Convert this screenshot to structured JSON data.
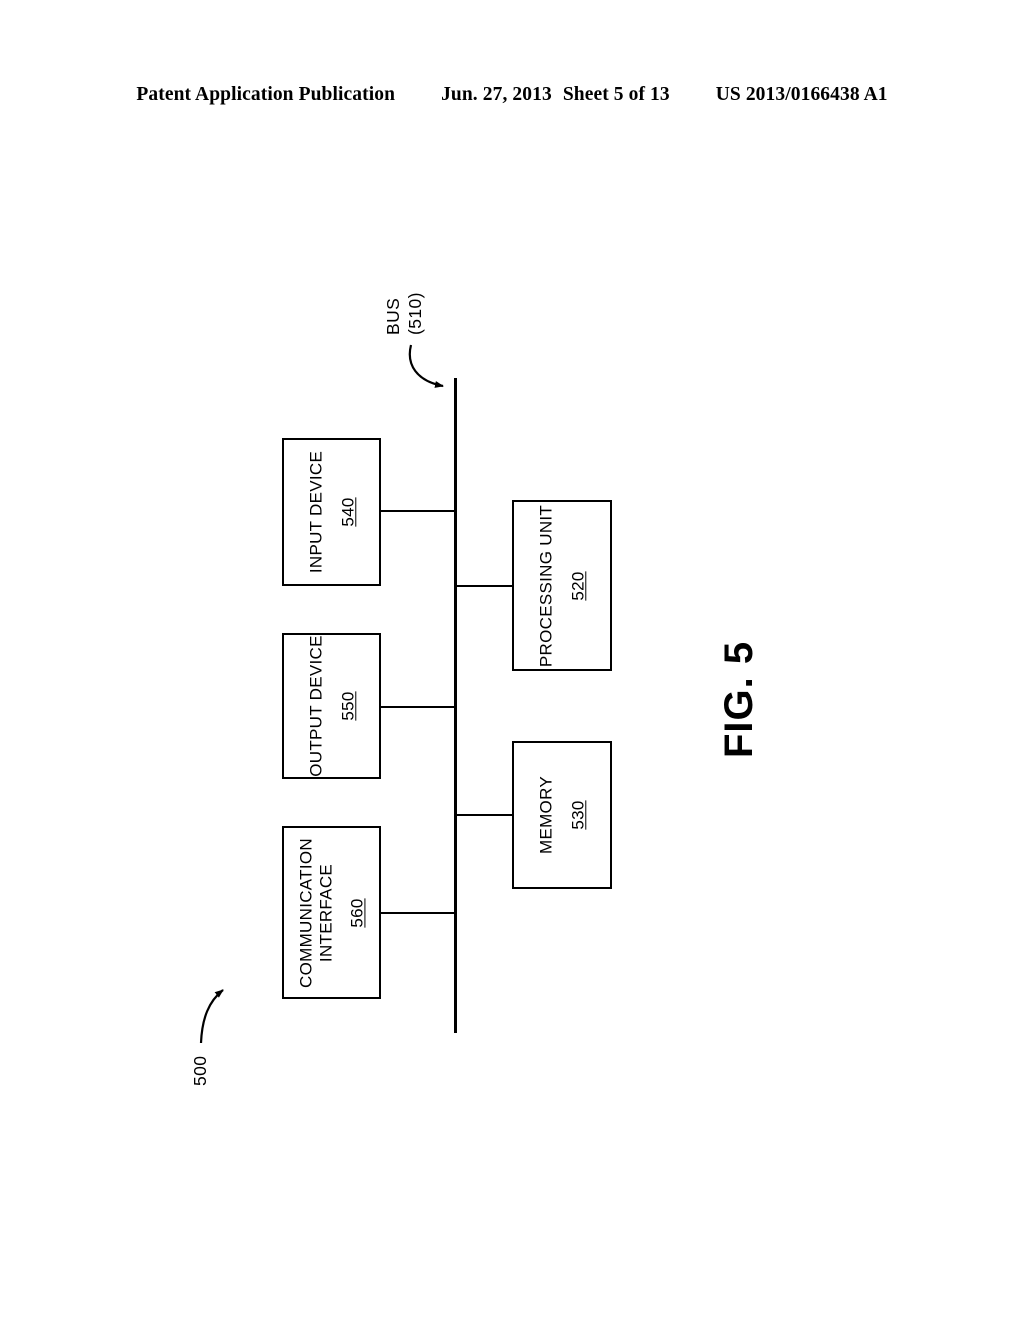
{
  "header": {
    "publication": "Patent Application Publication",
    "date": "Jun. 27, 2013",
    "sheet": "Sheet 5 of 13",
    "document_number": "US 2013/0166438 A1"
  },
  "figure": {
    "caption": "FIG. 5",
    "system_reference": "500",
    "bus": {
      "label": "BUS",
      "reference": "(510)"
    },
    "blocks": [
      {
        "name": "input-device",
        "label": "INPUT DEVICE",
        "label_line2": "",
        "reference": "540"
      },
      {
        "name": "output-device",
        "label": "OUTPUT DEVICE",
        "label_line2": "",
        "reference": "550"
      },
      {
        "name": "communication-interface",
        "label": "COMMUNICATION",
        "label_line2": "INTERFACE",
        "reference": "560"
      },
      {
        "name": "processing-unit",
        "label": "PROCESSING UNIT",
        "label_line2": "",
        "reference": "520"
      },
      {
        "name": "memory",
        "label": "MEMORY",
        "label_line2": "",
        "reference": "530"
      }
    ]
  },
  "colors": {
    "ink": "#000000",
    "paper": "#ffffff"
  }
}
